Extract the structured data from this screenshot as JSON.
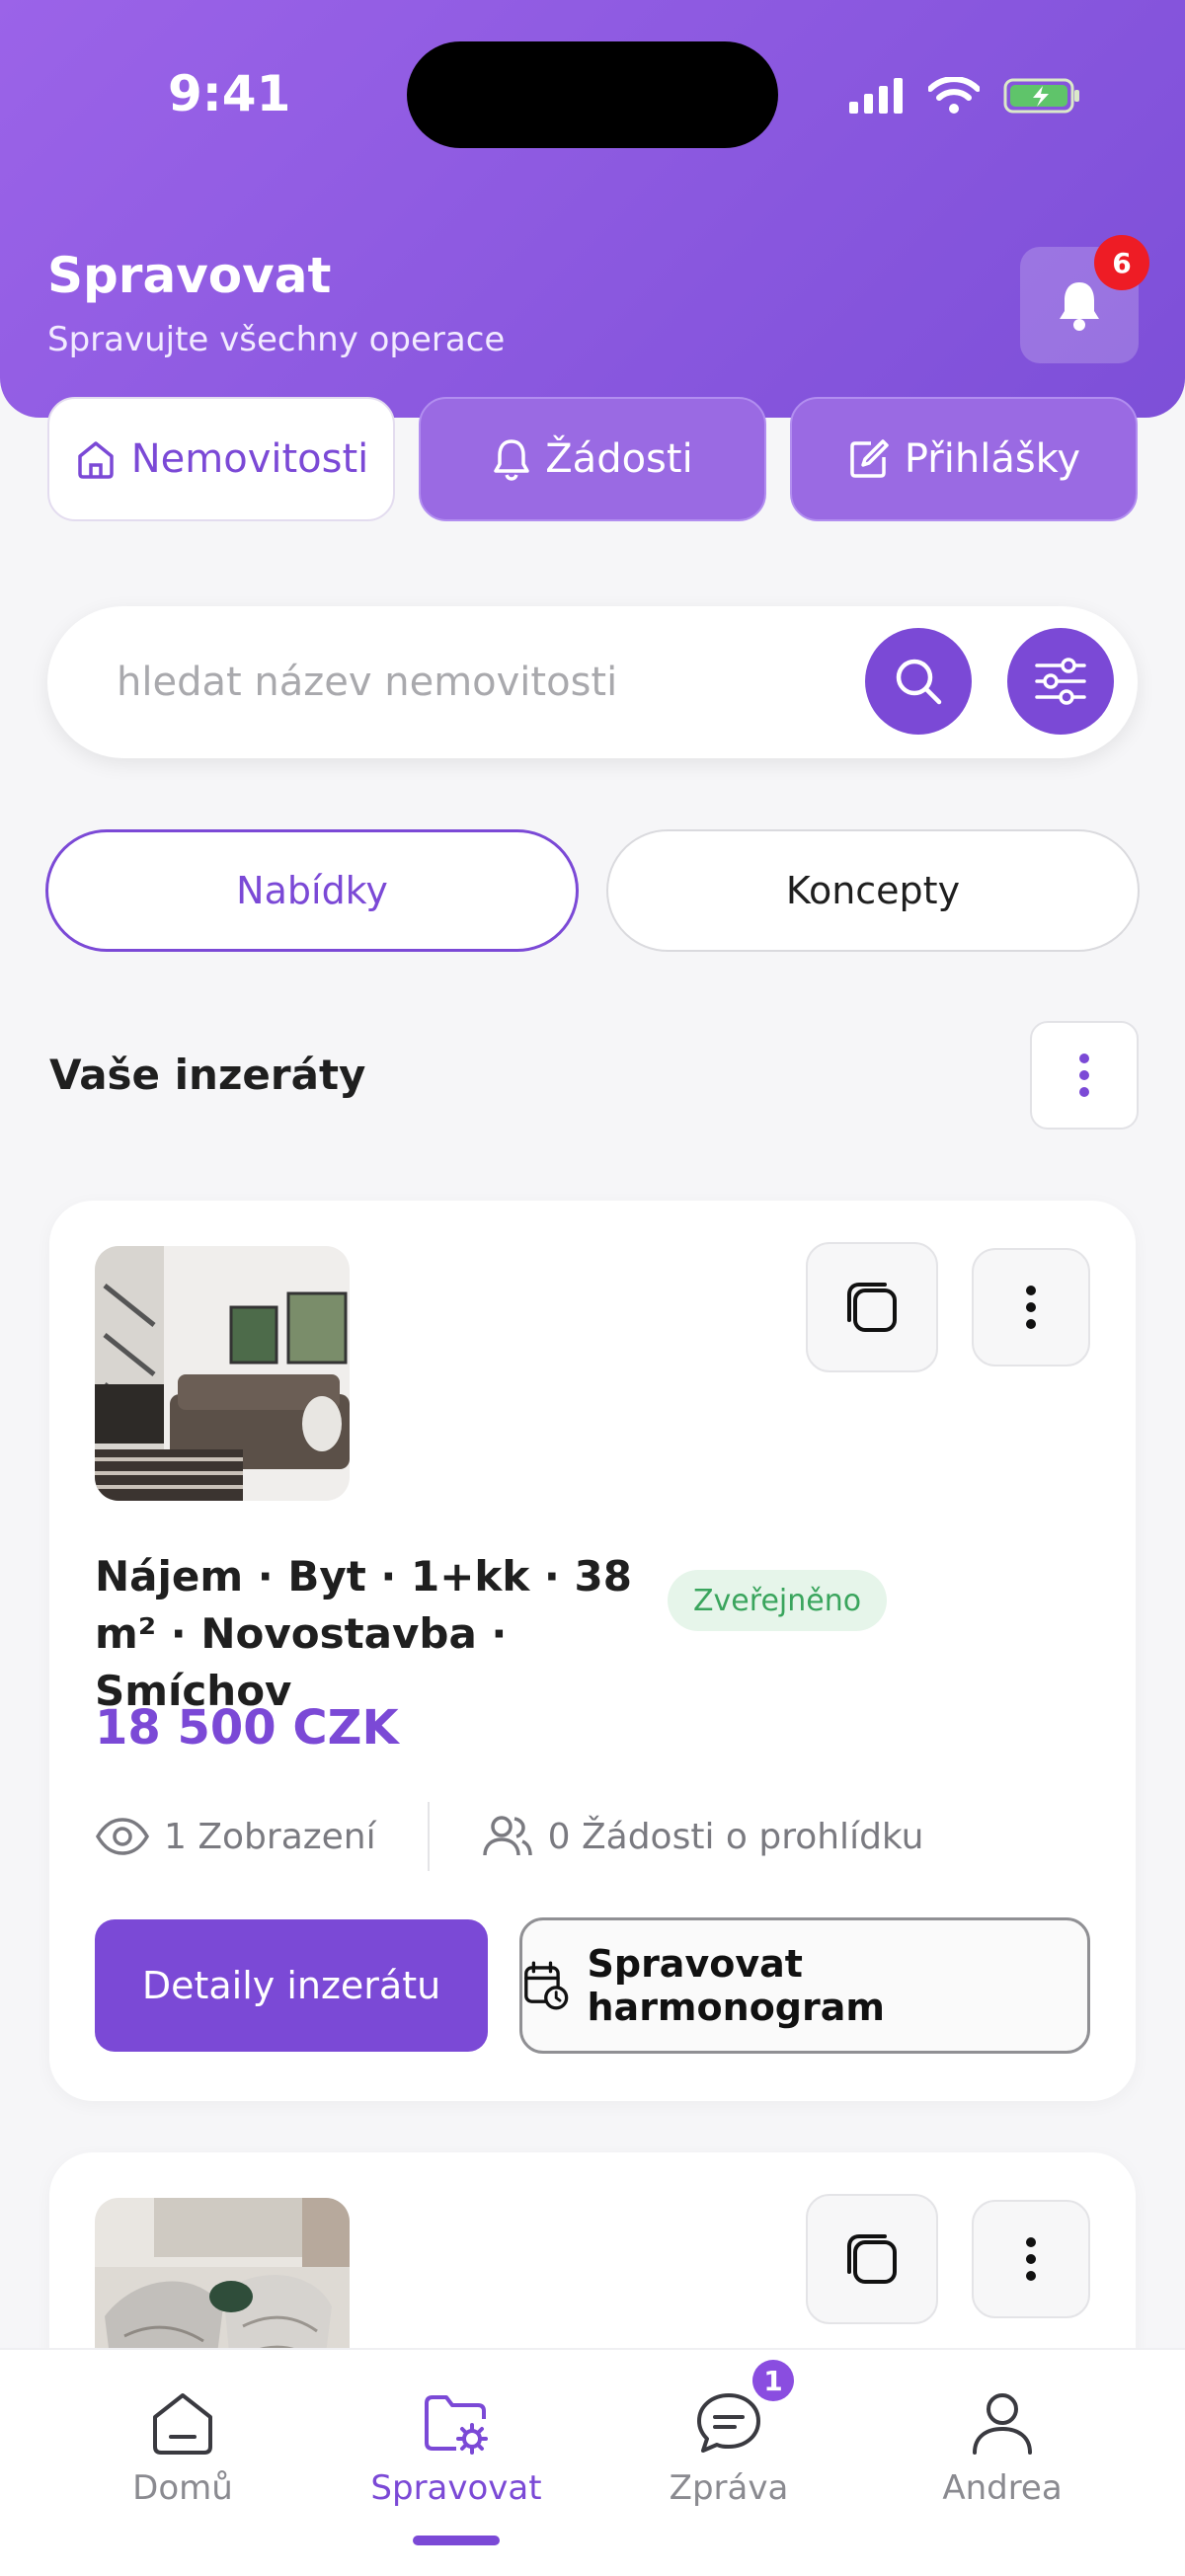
{
  "status_bar": {
    "time": "9:41"
  },
  "header": {
    "title": "Spravovat",
    "subtitle": "Spravujte všechny operace",
    "notification_count": "6"
  },
  "top_tabs": [
    {
      "label": "Nemovitosti",
      "icon": "home-icon",
      "active": true
    },
    {
      "label": "Žádosti",
      "icon": "bell-icon",
      "active": false
    },
    {
      "label": "Přihlášky",
      "icon": "edit-icon",
      "active": false
    }
  ],
  "search": {
    "placeholder": "hledat název nemovitosti",
    "value": ""
  },
  "segments": {
    "offers": "Nabídky",
    "drafts": "Koncepty"
  },
  "section": {
    "title": "Vaše inzeráty"
  },
  "listings": [
    {
      "title": "Nájem · Byt · 1+kk · 38 m² · Novostavba · Smíchov",
      "status": "Zveřejněno",
      "price": "18 500 CZK",
      "views": "1 Zobrazení",
      "requests": "0 Žádosti o prohlídku",
      "detail_button": "Detaily inzerátu",
      "schedule_button": "Spravovat harmonogram"
    }
  ],
  "bottom_nav": [
    {
      "label": "Domů",
      "icon": "home-icon"
    },
    {
      "label": "Spravovat",
      "icon": "folder-settings-icon",
      "active": true
    },
    {
      "label": "Zpráva",
      "icon": "chat-icon",
      "badge": "1"
    },
    {
      "label": "Andrea",
      "icon": "user-icon"
    }
  ],
  "colors": {
    "accent": "#7b49d6",
    "success": "#3aa55d",
    "danger": "#ee1c25"
  }
}
